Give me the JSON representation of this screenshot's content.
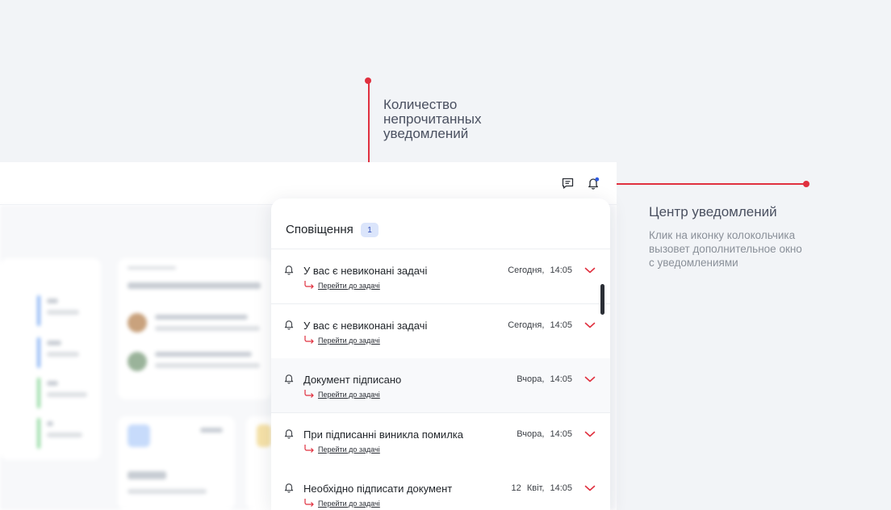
{
  "annotations": {
    "unread_count_label": "Количество непрочитанных уведомлений",
    "center_title": "Центр уведомлений",
    "center_description": "Клик на иконку колокольчика вызовет дополнительное окно с уведомлениями"
  },
  "header": {
    "icons": [
      "chat-icon",
      "bell-icon"
    ]
  },
  "panel": {
    "title": "Сповіщення",
    "unread_count": "1",
    "notifications": [
      {
        "title": "У вас є невиконані задачі",
        "date": "Сегодня,",
        "time": "14:05",
        "link": "Перейти до задачі"
      },
      {
        "title": "У вас є невиконані задачі",
        "date": "Сегодня,",
        "time": "14:05",
        "link": "Перейти до задачі"
      },
      {
        "title": "Документ підписано",
        "date": "Вчора,",
        "time": "14:05",
        "link": "Перейти до задачі"
      },
      {
        "title": "При підписанні виникла помилка",
        "date": "Вчора,",
        "time": "14:05",
        "link": "Перейти до задачі"
      },
      {
        "title": "Необхідно підписати документ",
        "date": "12 Квіт,",
        "time": "14:05",
        "link": "Перейти до задачі"
      }
    ]
  },
  "colors": {
    "accent_red": "#e0303f",
    "badge_bg": "#dbe5fb",
    "unread_dot": "#2f5be0"
  }
}
